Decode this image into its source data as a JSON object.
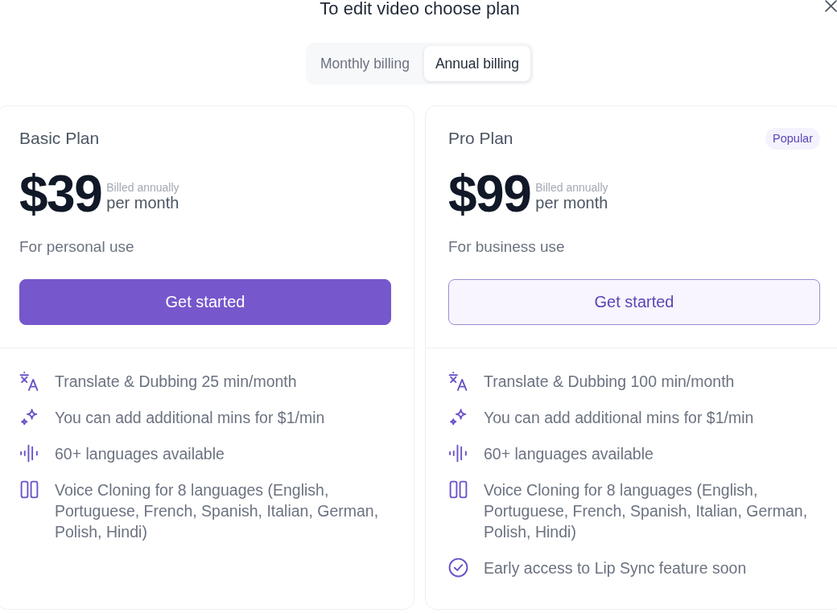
{
  "dialog": {
    "title": "To edit video choose plan"
  },
  "billing_tabs": [
    {
      "label": "Monthly billing",
      "selected": false
    },
    {
      "label": "Annual billing",
      "selected": true
    }
  ],
  "plans": [
    {
      "name": "Basic Plan",
      "price": "$39",
      "billing_note": "Billed annually",
      "period": "per month",
      "audience": "For personal use",
      "button": {
        "label": "Get started",
        "kind": "primary"
      },
      "features": [
        {
          "kind": "translation",
          "text": "Translate & Dubbing 25 min/month"
        },
        {
          "kind": "addon",
          "text": "You can add additional mins for $1/min"
        },
        {
          "kind": "languages",
          "text": "60+ languages available"
        },
        {
          "kind": "cloning",
          "text": "Voice Cloning for 8 languages (English, Portuguese, French, Spanish, Italian, German, Polish, Hindi)"
        }
      ]
    },
    {
      "name": "Pro Plan",
      "badge": "Popular",
      "price": "$99",
      "billing_note": "Billed annually",
      "period": "per month",
      "audience": "For business use",
      "button": {
        "label": "Get started",
        "kind": "outline"
      },
      "features": [
        {
          "kind": "translation",
          "text": "Translate & Dubbing 100 min/month"
        },
        {
          "kind": "addon",
          "text": "You can add additional mins for $1/min"
        },
        {
          "kind": "languages",
          "text": "60+ languages available"
        },
        {
          "kind": "cloning",
          "text": "Voice Cloning for 8 languages (English, Portuguese, French, Spanish, Italian, German, Polish, Hindi)"
        },
        {
          "kind": "access",
          "text": "Early access to Lip Sync feature soon"
        }
      ]
    }
  ]
}
